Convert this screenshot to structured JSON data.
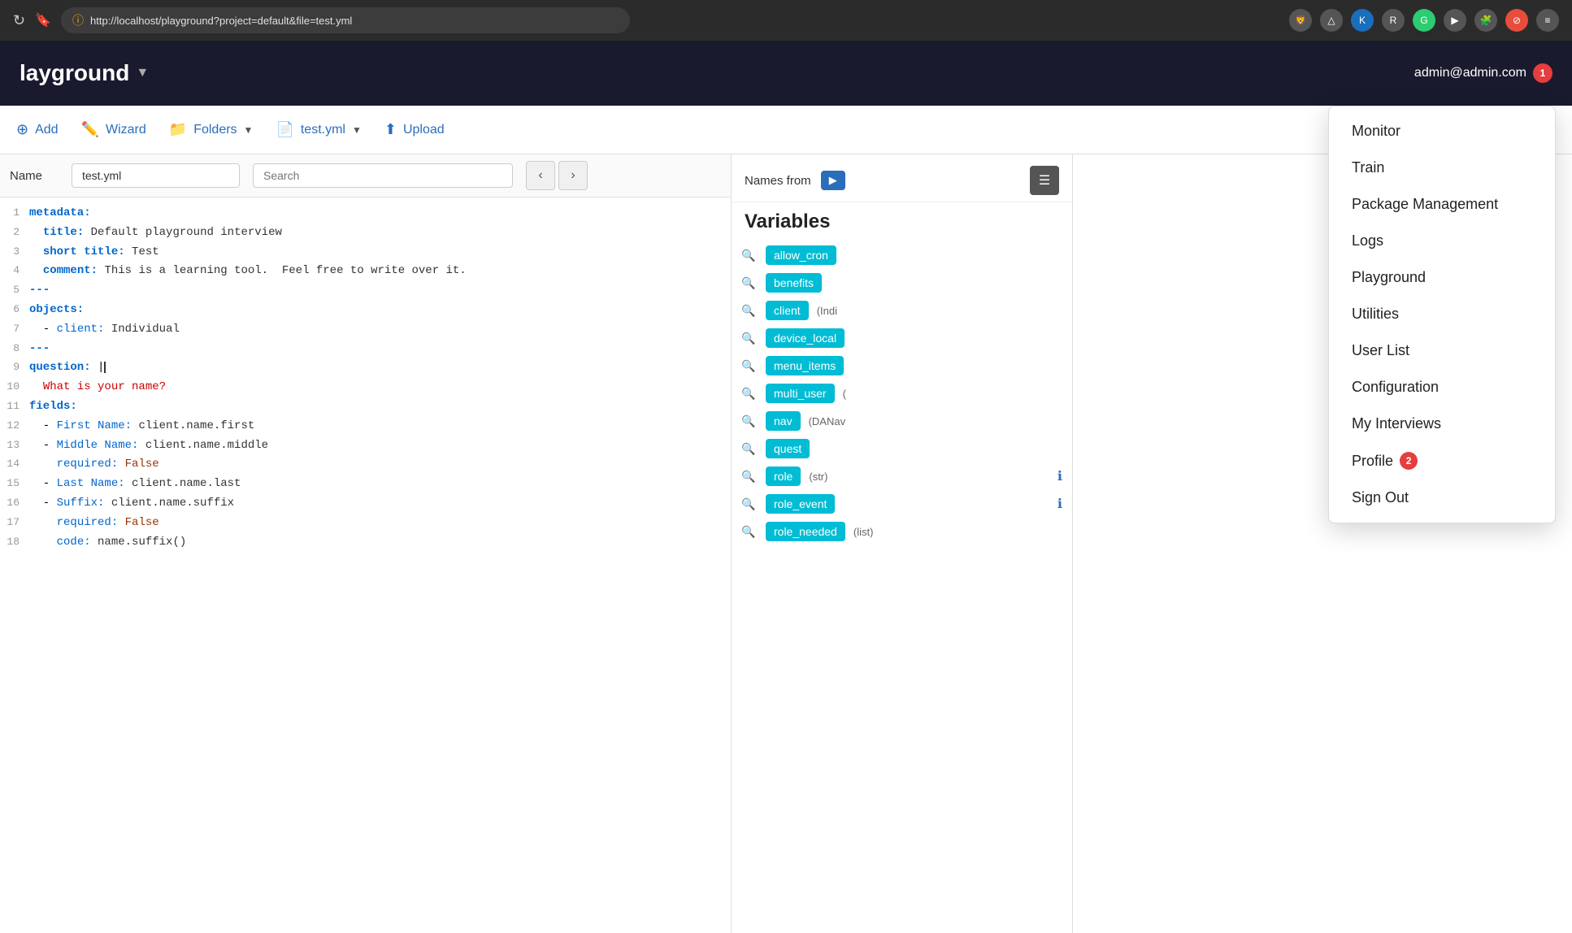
{
  "browser": {
    "url": "http://localhost/playground?project=default&file=test.yml",
    "refresh_icon": "↻",
    "bookmark_icon": "🔖",
    "security_icon": "ⓘ"
  },
  "app": {
    "title": "layground",
    "title_arrow": "▼",
    "user_email": "admin@admin.com",
    "user_badge": "1"
  },
  "toolbar": {
    "add_label": "Add",
    "wizard_label": "Wizard",
    "folders_label": "Folders",
    "file_label": "test.yml",
    "upload_label": "Upload"
  },
  "editor": {
    "file_name_label": "Name",
    "file_name_value": "test.yml",
    "search_placeholder": "Search",
    "nav_prev": "‹",
    "nav_next": "›"
  },
  "code_lines": [
    {
      "num": "1",
      "content": "metadata:"
    },
    {
      "num": "2",
      "content": "  title: Default playground interview"
    },
    {
      "num": "3",
      "content": "  short title: Test"
    },
    {
      "num": "4",
      "content": "  comment: This is a learning tool.  Feel free to write over it."
    },
    {
      "num": "5",
      "content": "---"
    },
    {
      "num": "6",
      "content": "objects:"
    },
    {
      "num": "7",
      "content": "  - client: Individual"
    },
    {
      "num": "8",
      "content": "---"
    },
    {
      "num": "9",
      "content": "question: |"
    },
    {
      "num": "10",
      "content": "  What is your name?"
    },
    {
      "num": "11",
      "content": "fields:"
    },
    {
      "num": "12",
      "content": "  - First Name: client.name.first"
    },
    {
      "num": "13",
      "content": "  - Middle Name: client.name.middle"
    },
    {
      "num": "14",
      "content": "    required: False"
    },
    {
      "num": "15",
      "content": "  - Last Name: client.name.last"
    },
    {
      "num": "16",
      "content": "  - Suffix: client.name.suffix"
    },
    {
      "num": "17",
      "content": "    required: False"
    },
    {
      "num": "18",
      "content": "    code: name.suffix()"
    }
  ],
  "variables_panel": {
    "names_from_label": "Names from",
    "variables_title": "Variables",
    "items": [
      {
        "id": "allow_cron",
        "label": "allow_cron",
        "meta": "",
        "has_info": false
      },
      {
        "id": "benefits",
        "label": "benefits",
        "meta": "",
        "has_info": false
      },
      {
        "id": "client",
        "label": "client",
        "meta": "(Indi",
        "has_info": false
      },
      {
        "id": "device_local",
        "label": "device_local",
        "meta": "",
        "has_info": false
      },
      {
        "id": "menu_items",
        "label": "menu_items",
        "meta": "",
        "has_info": false
      },
      {
        "id": "multi_user",
        "label": "multi_user",
        "meta": "(",
        "has_info": false
      },
      {
        "id": "nav",
        "label": "nav",
        "meta": "(DANav",
        "has_info": false
      },
      {
        "id": "quest",
        "label": "quest",
        "meta": "",
        "has_info": false
      },
      {
        "id": "role",
        "label": "role",
        "meta": "(str)",
        "has_info": true
      },
      {
        "id": "role_event",
        "label": "role_event",
        "meta": "",
        "has_info": true
      },
      {
        "id": "role_needed",
        "label": "role_needed",
        "meta": "(list)",
        "has_info": false
      }
    ]
  },
  "dropdown_menu": {
    "items": [
      {
        "id": "monitor",
        "label": "Monitor",
        "badge": null
      },
      {
        "id": "train",
        "label": "Train",
        "badge": null
      },
      {
        "id": "package-management",
        "label": "Package Management",
        "badge": null
      },
      {
        "id": "logs",
        "label": "Logs",
        "badge": null
      },
      {
        "id": "playground",
        "label": "Playground",
        "badge": null
      },
      {
        "id": "utilities",
        "label": "Utilities",
        "badge": null
      },
      {
        "id": "user-list",
        "label": "User List",
        "badge": null
      },
      {
        "id": "configuration",
        "label": "Configuration",
        "badge": null
      },
      {
        "id": "my-interviews",
        "label": "My Interviews",
        "badge": null
      },
      {
        "id": "profile",
        "label": "Profile",
        "badge": "2"
      },
      {
        "id": "sign-out",
        "label": "Sign Out",
        "badge": null
      }
    ]
  },
  "bottom_tabs": [
    {
      "id": "tab-1",
      "label": "",
      "color": "blue"
    },
    {
      "id": "tab-2",
      "label": "",
      "color": "yellow"
    },
    {
      "id": "tab-3",
      "label": "",
      "color": "green"
    },
    {
      "id": "tab-4",
      "label": "",
      "color": "red"
    },
    {
      "id": "tab-5",
      "label": "",
      "color": "gray"
    }
  ]
}
